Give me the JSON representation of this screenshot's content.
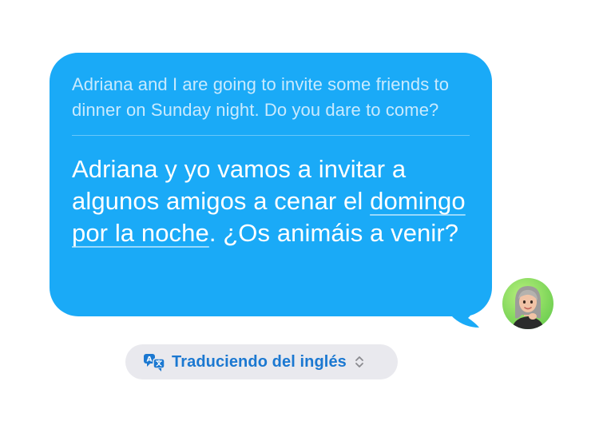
{
  "message": {
    "original_text": "Adriana and I are going to invite some friends to dinner on Sunday night. Do you dare to come?",
    "translated": {
      "part1": "Adriana y yo vamos a invitar a algunos amigos a cenar el ",
      "underlined": "domingo por la noche",
      "part2": ". ¿Os animáis a venir?"
    }
  },
  "translation_status": {
    "label": "Traduciendo del inglés",
    "icon": "translate-icon",
    "chevron_icon": "chevron-up-down-icon"
  },
  "avatar": {
    "icon": "memoji-avatar"
  },
  "colors": {
    "bubble": "#1aaaf7",
    "status_text": "#1b78d1",
    "pill_bg": "#e9e9ee"
  }
}
